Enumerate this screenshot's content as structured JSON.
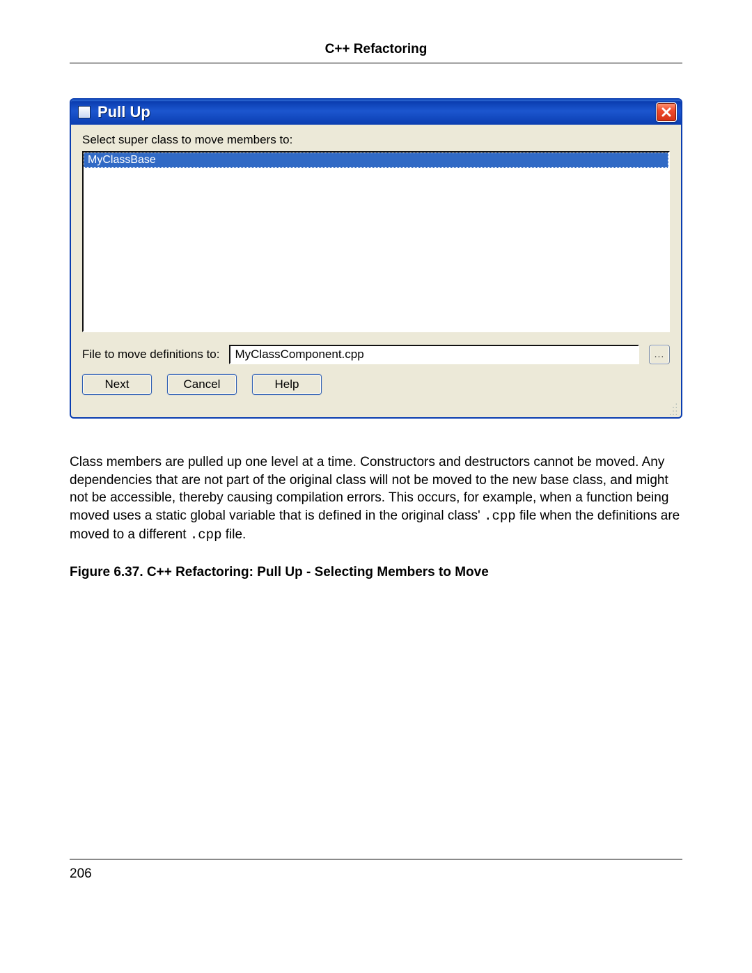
{
  "page": {
    "header": "C++ Refactoring",
    "number": "206"
  },
  "dialog": {
    "title": "Pull Up",
    "select_label": "Select super class to move members to:",
    "list_items": [
      "MyClassBase"
    ],
    "file_label": "File to move definitions to:",
    "file_value": "MyClassComponent.cpp",
    "browse_label": "...",
    "buttons": {
      "next": "Next",
      "cancel": "Cancel",
      "help": "Help"
    }
  },
  "paragraph": {
    "p1": "Class members are pulled up one level at a time. Constructors and destructors cannot be moved. Any dependencies that are not part of the original class will not be moved to the new base class, and might not be accessible, thereby causing compilation errors. This occurs, for example, when a function being moved uses a static global variable that is defined in the original class' ",
    "code1": ".cpp",
    "p2": " file when the definitions are moved to a different ",
    "code2": ".cpp",
    "p3": " file."
  },
  "figure_caption": "Figure 6.37.  C++ Refactoring: Pull Up - Selecting Members to Move"
}
